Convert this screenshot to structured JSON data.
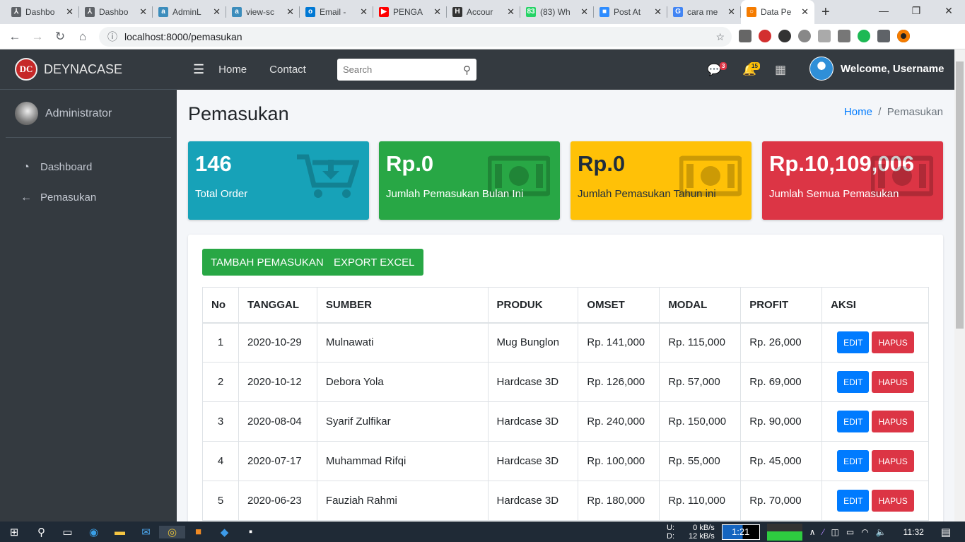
{
  "browser": {
    "tabs": [
      {
        "title": "Dashbo",
        "color": "#5f6368",
        "glyph": "⅄"
      },
      {
        "title": "Dashbo",
        "color": "#5f6368",
        "glyph": "⅄"
      },
      {
        "title": "AdminL",
        "color": "#3c8dbc",
        "glyph": "a"
      },
      {
        "title": "view-sc",
        "color": "#3c8dbc",
        "glyph": "a"
      },
      {
        "title": "Email -",
        "color": "#0078d4",
        "glyph": "o"
      },
      {
        "title": "PENGA",
        "color": "#ff0000",
        "glyph": "▶"
      },
      {
        "title": "Accour",
        "color": "#333333",
        "glyph": "H"
      },
      {
        "title": "(83) Wh",
        "color": "#25d366",
        "glyph": "83"
      },
      {
        "title": "Post At",
        "color": "#2d8cff",
        "glyph": "■"
      },
      {
        "title": "cara me",
        "color": "#4285f4",
        "glyph": "G"
      },
      {
        "title": "Data Pe",
        "color": "#f57c00",
        "glyph": "○",
        "active": true
      }
    ],
    "url": "localhost:8000/pemasukan"
  },
  "sidebar": {
    "brand": "DEYNACASE",
    "logo_text": "DC",
    "user": "Administrator",
    "items": [
      {
        "label": "Dashboard",
        "icon": "tachometer-icon"
      },
      {
        "label": "Pemasukan",
        "icon": "arrow-left-icon"
      }
    ]
  },
  "navbar": {
    "links": [
      "Home",
      "Contact"
    ],
    "search_placeholder": "Search",
    "messages_count": "3",
    "notifications_count": "15",
    "welcome": "Welcome, Username"
  },
  "page": {
    "title": "Pemasukan",
    "breadcrumb": [
      "Home",
      "Pemasukan"
    ]
  },
  "stats": [
    {
      "value": "146",
      "label": "Total Order",
      "color": "#17a2b8",
      "icon": "cart-download-icon"
    },
    {
      "value": "Rp.0",
      "label": "Jumlah Pemasukan Bulan Ini",
      "color": "#28a745",
      "icon": "money-bill-icon"
    },
    {
      "value": "Rp.0",
      "label": "Jumlah Pemasukan Tahun ini",
      "color": "#ffc107",
      "icon": "money-bill-icon"
    },
    {
      "value": "Rp.10,109,006",
      "label": "Jumlah Semua Pemasukan",
      "color": "#dc3545",
      "icon": "money-bill-icon"
    }
  ],
  "actions": {
    "add": "TAMBAH PEMASUKAN",
    "export": "EXPORT EXCEL"
  },
  "table": {
    "headers": [
      "No",
      "TANGGAL",
      "SUMBER",
      "PRODUK",
      "OMSET",
      "MODAL",
      "PROFIT",
      "AKSI"
    ],
    "edit_label": "EDIT",
    "delete_label": "HAPUS",
    "rows": [
      [
        "1",
        "2020-10-29",
        "Mulnawati",
        "Mug Bunglon",
        "Rp. 141,000",
        "Rp. 115,000",
        "Rp. 26,000"
      ],
      [
        "2",
        "2020-10-12",
        "Debora Yola",
        "Hardcase 3D",
        "Rp. 126,000",
        "Rp. 57,000",
        "Rp. 69,000"
      ],
      [
        "3",
        "2020-08-04",
        "Syarif Zulfikar",
        "Hardcase 3D",
        "Rp. 240,000",
        "Rp. 150,000",
        "Rp. 90,000"
      ],
      [
        "4",
        "2020-07-17",
        "Muhammad Rifqi",
        "Hardcase 3D",
        "Rp. 100,000",
        "Rp. 55,000",
        "Rp. 45,000"
      ],
      [
        "5",
        "2020-06-23",
        "Fauziah Rahmi",
        "Hardcase 3D",
        "Rp. 180,000",
        "Rp. 110,000",
        "Rp. 70,000"
      ]
    ]
  },
  "taskbar": {
    "net_up_label": "U:",
    "net_up": "0 kB/s",
    "net_down_label": "D:",
    "net_down": "12 kB/s",
    "battery_time": "1:21",
    "clock": "11:32"
  }
}
